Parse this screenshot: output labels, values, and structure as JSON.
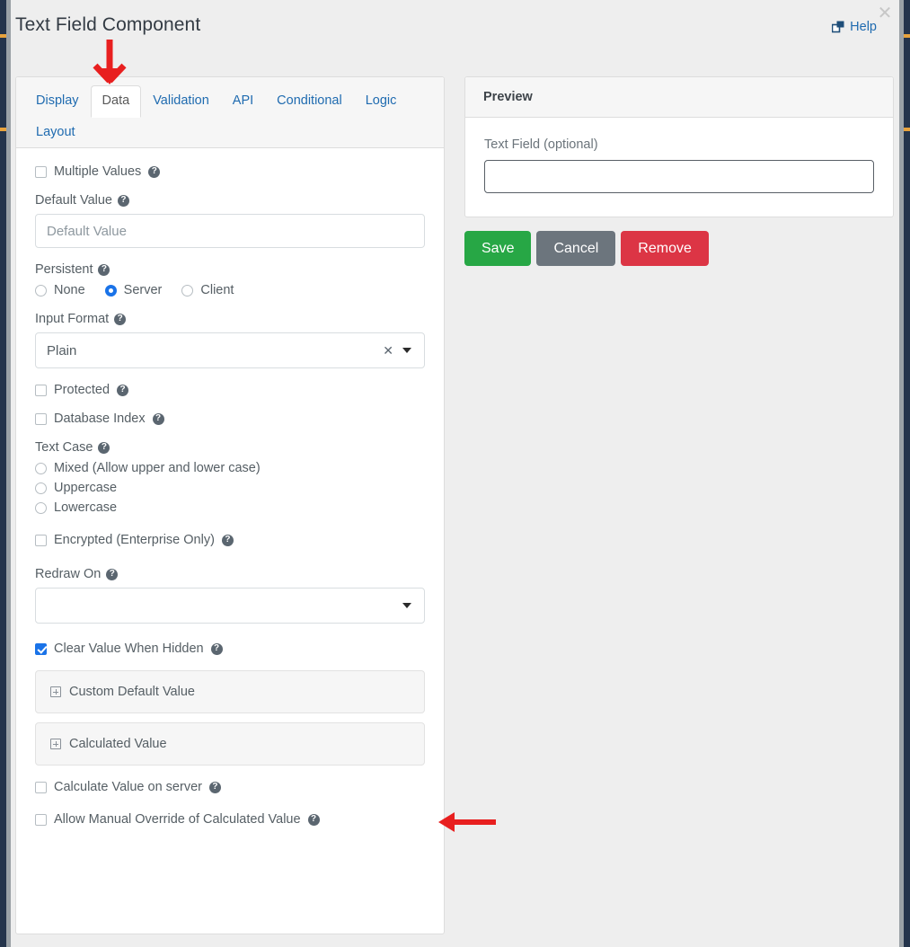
{
  "window": {
    "title": "Text Field Component",
    "help_label": "Help",
    "help_icon": "external-window-icon",
    "close_icon": "close-icon"
  },
  "tabs": {
    "items": [
      {
        "label": "Display",
        "active": false
      },
      {
        "label": "Data",
        "active": true
      },
      {
        "label": "Validation",
        "active": false
      },
      {
        "label": "API",
        "active": false
      },
      {
        "label": "Conditional",
        "active": false
      },
      {
        "label": "Logic",
        "active": false
      },
      {
        "label": "Layout",
        "active": false
      }
    ]
  },
  "data_tab": {
    "multiple_values": {
      "label": "Multiple Values",
      "checked": false
    },
    "default_value": {
      "label": "Default Value",
      "placeholder": "Default Value",
      "value": ""
    },
    "persistent": {
      "label": "Persistent",
      "options": [
        "None",
        "Server",
        "Client"
      ],
      "selected": "Server"
    },
    "input_format": {
      "label": "Input Format",
      "value": "Plain",
      "clear_icon": "clear-x-icon",
      "caret_icon": "chevron-down-icon"
    },
    "protected": {
      "label": "Protected",
      "checked": false
    },
    "database_index": {
      "label": "Database Index",
      "checked": false
    },
    "text_case": {
      "label": "Text Case",
      "options": [
        "Mixed (Allow upper and lower case)",
        "Uppercase",
        "Lowercase"
      ],
      "selected": ""
    },
    "encrypted": {
      "label": "Encrypted (Enterprise Only)",
      "checked": false
    },
    "redraw_on": {
      "label": "Redraw On",
      "value": "",
      "caret_icon": "chevron-down-icon"
    },
    "clear_value_when_hidden": {
      "label": "Clear Value When Hidden",
      "checked": true
    },
    "panels": [
      {
        "label": "Custom Default Value",
        "expanded": false,
        "icon": "expand-plus-icon"
      },
      {
        "label": "Calculated Value",
        "expanded": false,
        "icon": "expand-plus-icon"
      }
    ],
    "calculate_on_server": {
      "label": "Calculate Value on server",
      "checked": false
    },
    "allow_manual_override": {
      "label": "Allow Manual Override of Calculated Value",
      "checked": false
    },
    "help_icon": "question-mark-icon"
  },
  "preview": {
    "title": "Preview",
    "field_label": "Text Field (optional)",
    "field_value": "",
    "field_placeholder": ""
  },
  "actions": {
    "save": "Save",
    "cancel": "Cancel",
    "remove": "Remove"
  },
  "annotations": [
    {
      "name": "arrow-pointing-to-data-tab",
      "direction": "down",
      "color": "#e81f1f"
    },
    {
      "name": "arrow-pointing-to-calculated-value",
      "direction": "left",
      "color": "#e81f1f"
    }
  ],
  "colors": {
    "link": "#1f6bb0",
    "save": "#27a745",
    "cancel": "#6c757d",
    "remove": "#dc3545",
    "checkbox_checked": "#1a73e8",
    "annotation": "#e81f1f"
  }
}
